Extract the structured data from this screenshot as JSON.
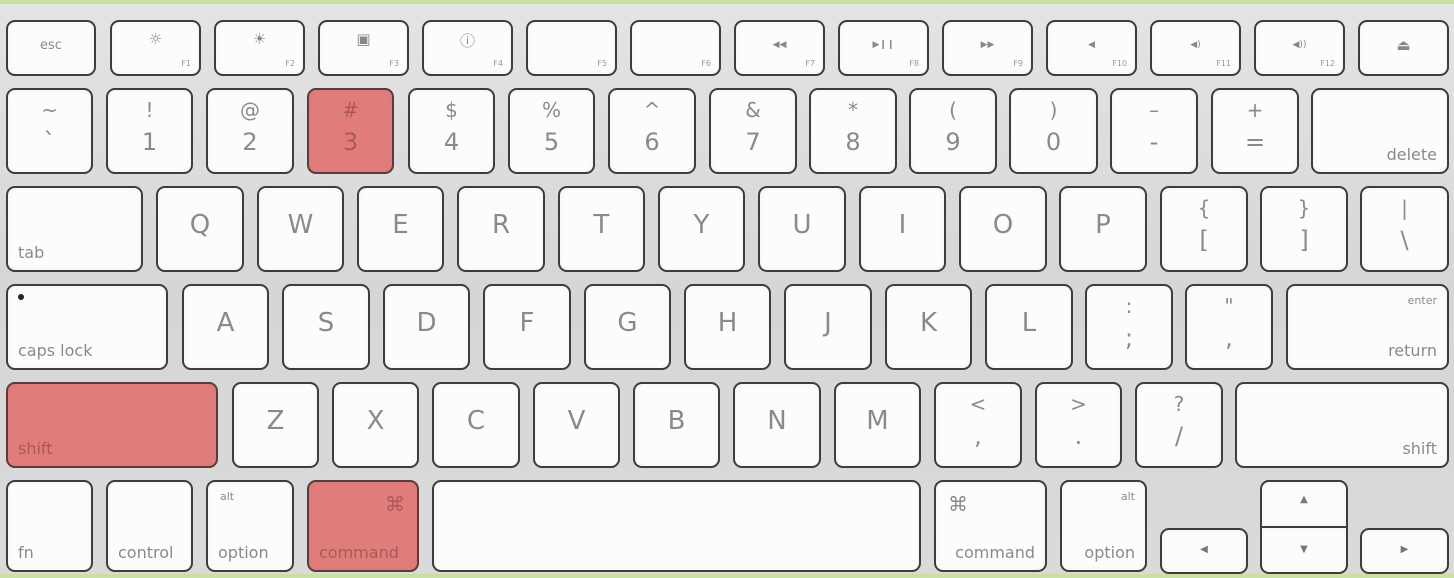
{
  "highlight_color": "#e07d7b",
  "highlighted_keys": [
    "3",
    "shift-left",
    "command-left"
  ],
  "rows": {
    "function": {
      "esc": "esc",
      "f1": {
        "label": "F1",
        "icon": "brightness-down-icon",
        "glyph": "☼"
      },
      "f2": {
        "label": "F2",
        "icon": "brightness-up-icon",
        "glyph": "☀"
      },
      "f3": {
        "label": "F3",
        "icon": "expose-icon",
        "glyph": "▣"
      },
      "f4": {
        "label": "F4",
        "icon": "dashboard-icon",
        "glyph": "ⓘ"
      },
      "f5": {
        "label": "F5"
      },
      "f6": {
        "label": "F6"
      },
      "f7": {
        "label": "F7",
        "icon": "rewind-icon",
        "glyph": "◀◀"
      },
      "f8": {
        "label": "F8",
        "icon": "play-pause-icon",
        "glyph": "▶❙❙"
      },
      "f9": {
        "label": "F9",
        "icon": "fast-forward-icon",
        "glyph": "▶▶"
      },
      "f10": {
        "label": "F10",
        "icon": "mute-icon",
        "glyph": "◀"
      },
      "f11": {
        "label": "F11",
        "icon": "volume-down-icon",
        "glyph": "◀)"
      },
      "f12": {
        "label": "F12",
        "icon": "volume-up-icon",
        "glyph": "◀))"
      },
      "eject": {
        "icon": "eject-icon",
        "glyph": "⏏"
      }
    },
    "number": [
      {
        "top": "~",
        "bottom": "`"
      },
      {
        "top": "!",
        "bottom": "1"
      },
      {
        "top": "@",
        "bottom": "2"
      },
      {
        "top": "#",
        "bottom": "3"
      },
      {
        "top": "$",
        "bottom": "4"
      },
      {
        "top": "%",
        "bottom": "5"
      },
      {
        "top": "^",
        "bottom": "6"
      },
      {
        "top": "&",
        "bottom": "7"
      },
      {
        "top": "*",
        "bottom": "8"
      },
      {
        "top": "(",
        "bottom": "9"
      },
      {
        "top": ")",
        "bottom": "0"
      },
      {
        "top": "–",
        "bottom": "-"
      },
      {
        "top": "+",
        "bottom": "="
      }
    ],
    "number_delete": "delete",
    "tab_label": "tab",
    "qwerty": [
      "Q",
      "W",
      "E",
      "R",
      "T",
      "Y",
      "U",
      "I",
      "O",
      "P"
    ],
    "brackets": [
      {
        "top": "{",
        "bottom": "["
      },
      {
        "top": "}",
        "bottom": "]"
      },
      {
        "top": "|",
        "bottom": "\\"
      }
    ],
    "caps_label": "caps lock",
    "asdf": [
      "A",
      "S",
      "D",
      "F",
      "G",
      "H",
      "J",
      "K",
      "L"
    ],
    "punct_home": [
      {
        "top": ":",
        "bottom": ";"
      },
      {
        "top": "\"",
        "bottom": ","
      }
    ],
    "return": {
      "top": "enter",
      "bottom": "return"
    },
    "shift_left": "shift",
    "zxcv": [
      "Z",
      "X",
      "C",
      "V",
      "B",
      "N",
      "M"
    ],
    "punct_bottom": [
      {
        "top": "<",
        "bottom": ","
      },
      {
        "top": ">",
        "bottom": "."
      },
      {
        "top": "?",
        "bottom": "/"
      }
    ],
    "shift_right": "shift",
    "modifiers": {
      "fn": "fn",
      "control": "control",
      "option_left": {
        "top": "alt",
        "bottom": "option"
      },
      "command_left": {
        "symbol": "⌘",
        "label": "command"
      },
      "command_right": {
        "symbol": "⌘",
        "label": "command"
      },
      "option_right": {
        "top": "alt",
        "bottom": "option"
      }
    },
    "arrows": {
      "up": "▲",
      "down": "▼",
      "left": "◀",
      "right": "▶"
    }
  }
}
